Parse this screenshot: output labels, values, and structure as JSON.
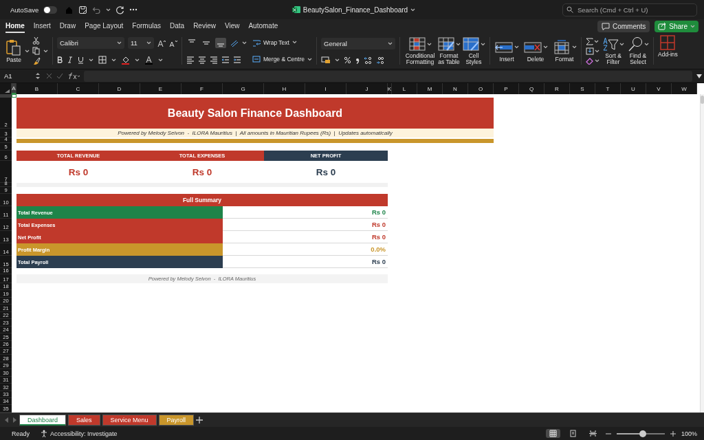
{
  "window": {
    "title": "BeautySalon_Finance_Dashboard"
  },
  "autosave": {
    "label": "AutoSave",
    "on": false
  },
  "search": {
    "placeholder": "Search (Cmd + Ctrl + U)"
  },
  "ribbon_tabs": [
    {
      "label": "Home",
      "selected": true
    },
    {
      "label": "Insert",
      "selected": false
    },
    {
      "label": "Draw",
      "selected": false
    },
    {
      "label": "Page Layout",
      "selected": false
    },
    {
      "label": "Formulas",
      "selected": false
    },
    {
      "label": "Data",
      "selected": false
    },
    {
      "label": "Review",
      "selected": false
    },
    {
      "label": "View",
      "selected": false
    },
    {
      "label": "Automate",
      "selected": false
    }
  ],
  "comments_button": "Comments",
  "share_button": "Share",
  "ribbon": {
    "paste": "Paste",
    "font_name": "Calibri",
    "font_size": "11",
    "vertical_align": [
      {
        "selected": false
      },
      {
        "selected": false
      },
      {
        "selected": true
      }
    ],
    "wrap_text": "Wrap Text",
    "merge": "Merge & Centre",
    "number_format": "General",
    "styles": [
      "Conditional Formatting",
      "Format as Table",
      "Cell Styles"
    ],
    "cells": [
      "Insert",
      "Delete",
      "Format"
    ],
    "editing": [
      "Sort & Filter",
      "Find & Select"
    ],
    "add_ins": "Add-ins"
  },
  "formula_bar": {
    "name_box": "A1"
  },
  "columns": [
    {
      "label": "A",
      "selected": true
    },
    {
      "label": "B",
      "selected": false
    },
    {
      "label": "C",
      "selected": false
    },
    {
      "label": "D",
      "selected": false
    },
    {
      "label": "E",
      "selected": false
    },
    {
      "label": "F",
      "selected": false
    },
    {
      "label": "G",
      "selected": false
    },
    {
      "label": "H",
      "selected": false
    },
    {
      "label": "I",
      "selected": false
    },
    {
      "label": "J",
      "selected": false
    },
    {
      "label": "K",
      "selected": false
    },
    {
      "label": "L",
      "selected": false
    },
    {
      "label": "M",
      "selected": false
    },
    {
      "label": "N",
      "selected": false
    },
    {
      "label": "O",
      "selected": false
    },
    {
      "label": "P",
      "selected": false
    },
    {
      "label": "Q",
      "selected": false
    },
    {
      "label": "R",
      "selected": false
    },
    {
      "label": "S",
      "selected": false
    },
    {
      "label": "T",
      "selected": false
    },
    {
      "label": "U",
      "selected": false
    },
    {
      "label": "V",
      "selected": false
    },
    {
      "label": "W",
      "selected": false
    }
  ],
  "rows": [
    "2",
    "3",
    "4",
    "5",
    "6",
    "7",
    "8",
    "9",
    "10",
    "11",
    "12",
    "13",
    "14",
    "15",
    "16",
    "17",
    "18",
    "19",
    "20",
    "21",
    "22",
    "23",
    "24",
    "25",
    "26",
    "27",
    "28",
    "29",
    "30",
    "31",
    "32",
    "33",
    "34",
    "35"
  ],
  "dashboard": {
    "title": "Beauty Salon Finance Dashboard",
    "subtitle": "Powered by Melody Selvon  -  ILORA Mauritius  |  All amounts in Mauritian Rupees (Rs)  |  Updates automatically",
    "kpis": [
      {
        "label": "TOTAL REVENUE",
        "value": "Rs 0",
        "color": "#c0392b"
      },
      {
        "label": "TOTAL EXPENSES",
        "value": "Rs 0",
        "color": "#c0392b"
      },
      {
        "label": "NET PROFIT",
        "value": "Rs 0",
        "color": "#2c3e50"
      }
    ],
    "summary": {
      "title": "Full Summary",
      "rows": [
        {
          "label": "Total Revenue",
          "value": "Rs 0",
          "color": "#1e8449"
        },
        {
          "label": "Total Expenses",
          "value": "Rs 0",
          "color": "#c0392b"
        },
        {
          "label": "Net Profit",
          "value": "Rs 0",
          "color": "#c0392b"
        },
        {
          "label": "Profit Margin",
          "value": "0.0%",
          "color": "#c9962b"
        },
        {
          "label": "Total Payroll",
          "value": "Rs 0",
          "color": "#2c3e50"
        }
      ]
    },
    "footer": "Powered by Melody Selvon  -  ILORA Mauritius"
  },
  "sheet_tabs": [
    {
      "label": "Dashboard",
      "selected": true,
      "color": "#1e8449"
    },
    {
      "label": "Sales",
      "selected": false,
      "color": "#c0392b"
    },
    {
      "label": "Service Menu",
      "selected": false,
      "color": "#c0392b"
    },
    {
      "label": "Payroll",
      "selected": false,
      "color": "#c9962b"
    }
  ],
  "status_bar": {
    "ready": "Ready",
    "accessibility": "Accessibility: Investigate",
    "views": [
      {
        "selected": true
      },
      {
        "selected": false
      },
      {
        "selected": false
      }
    ],
    "zoom_slider": {
      "level": 0.55
    },
    "zoom": "100%"
  }
}
